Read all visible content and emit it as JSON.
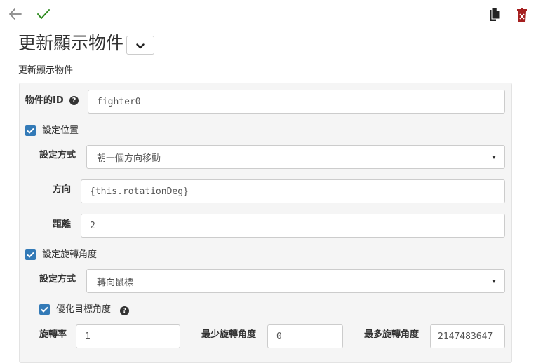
{
  "toolbar": {
    "back_icon": "arrow-left-icon",
    "confirm_icon": "checkmark-icon",
    "copy_icon": "copy-icon",
    "delete_icon": "trash-icon"
  },
  "header": {
    "title": "更新顯示物件",
    "subtitle": "更新顯示物件"
  },
  "form": {
    "object_id": {
      "label": "物件的ID",
      "value": "fighter0"
    },
    "set_position": {
      "label": "設定位置",
      "checked": true,
      "method": {
        "label": "設定方式",
        "value": "朝一個方向移動"
      },
      "direction": {
        "label": "方向",
        "value": "{this.rotationDeg}"
      },
      "distance": {
        "label": "距離",
        "value": "2"
      }
    },
    "set_rotation": {
      "label": "設定旋轉角度",
      "checked": true,
      "method": {
        "label": "設定方式",
        "value": "轉向鼠標"
      },
      "optimize": {
        "label": "優化目標角度",
        "checked": true
      },
      "rotation_rate": {
        "label": "旋轉率",
        "value": "1"
      },
      "min_rotation": {
        "label": "最少旋轉角度",
        "value": "0"
      },
      "max_rotation": {
        "label": "最多旋轉角度",
        "value": "2147483647"
      }
    }
  },
  "colors": {
    "accent": "#337ab7",
    "confirm": "#2e8b1f",
    "danger": "#a51f1f",
    "panel_bg": "#f5f5f5"
  }
}
